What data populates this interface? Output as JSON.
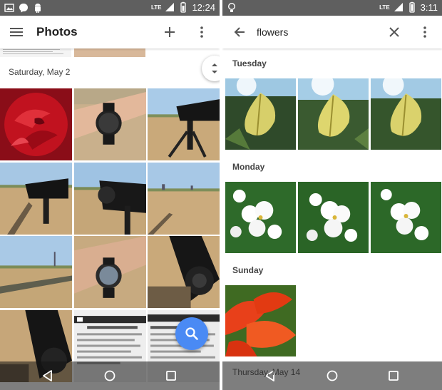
{
  "left": {
    "status": {
      "time": "12:24",
      "network": "LTE"
    },
    "appbar": {
      "title": "Photos"
    },
    "date_header": "Saturday, May 2"
  },
  "right": {
    "status": {
      "time": "3:11",
      "network": "LTE"
    },
    "search": {
      "query": "flowers"
    },
    "sections": [
      "Tuesday",
      "Monday",
      "Sunday",
      "Thursday, May 14"
    ]
  },
  "colors": {
    "status_bar": "#5f5f5f",
    "fab": "#4a8af4",
    "app_bar": "#ffffff"
  },
  "icons": [
    "menu-icon",
    "add-icon",
    "more-vert-icon",
    "back-arrow-icon",
    "close-icon",
    "search-icon",
    "nav-back-icon",
    "nav-home-icon",
    "nav-recents-icon"
  ]
}
